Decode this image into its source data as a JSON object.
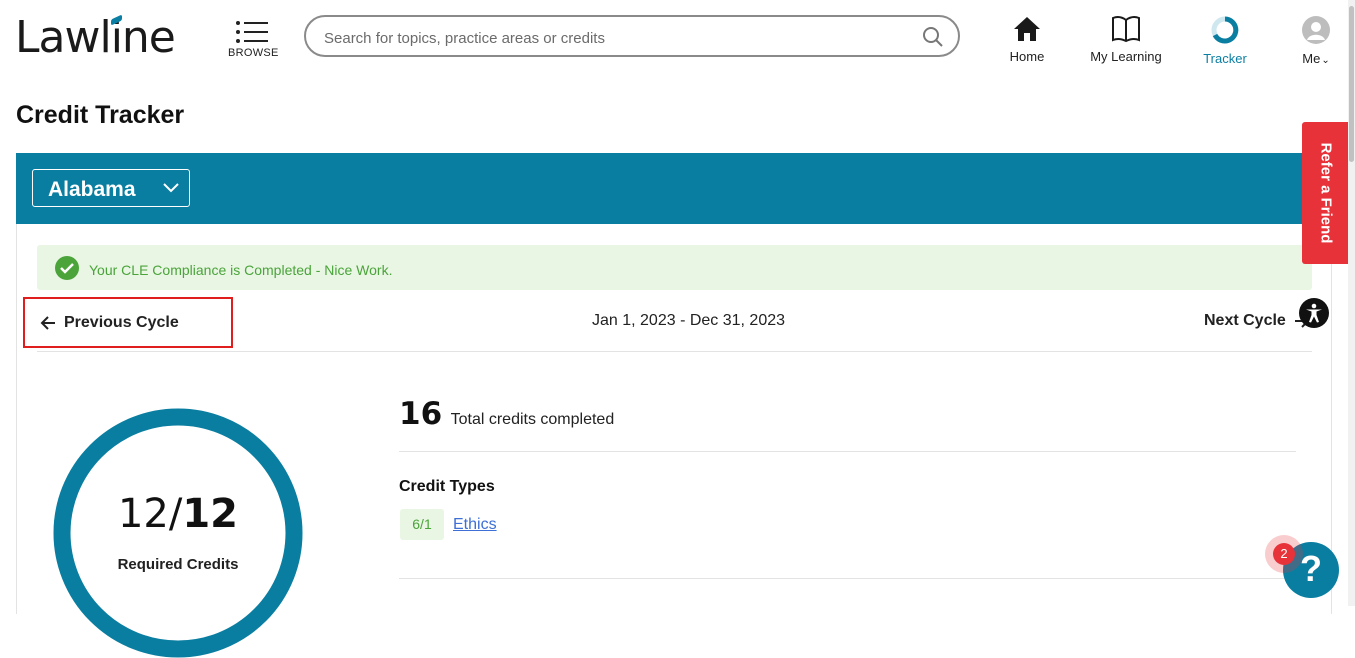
{
  "header": {
    "logo": "Lawline",
    "browse_label": "BROWSE",
    "search_placeholder": "Search for topics, practice areas or credits",
    "nav": {
      "home": "Home",
      "my_learning": "My Learning",
      "tracker": "Tracker",
      "me": "Me"
    }
  },
  "page": {
    "title": "Credit Tracker"
  },
  "tracker": {
    "state": "Alabama",
    "alert": "Your CLE Compliance is Completed - Nice Work.",
    "previous_cycle": "Previous Cycle",
    "cycle_range": "Jan 1, 2023 - Dec 31, 2023",
    "next_cycle": "Next Cycle",
    "required": {
      "completed": "12/",
      "total": "12",
      "label": "Required Credits",
      "progress": 1.0
    },
    "total_credits": {
      "value": "16",
      "label": "Total credits completed"
    },
    "credit_types_heading": "Credit Types",
    "credit_types": [
      {
        "badge": "6/1",
        "name": "Ethics"
      }
    ]
  },
  "widgets": {
    "refer": "Refer a Friend",
    "help_badge": "2",
    "help": "?"
  },
  "colors": {
    "brand": "#0a7ea1",
    "success": "#4aa43a",
    "alert_bg": "#e9f6e4",
    "refer": "#e8323a"
  }
}
